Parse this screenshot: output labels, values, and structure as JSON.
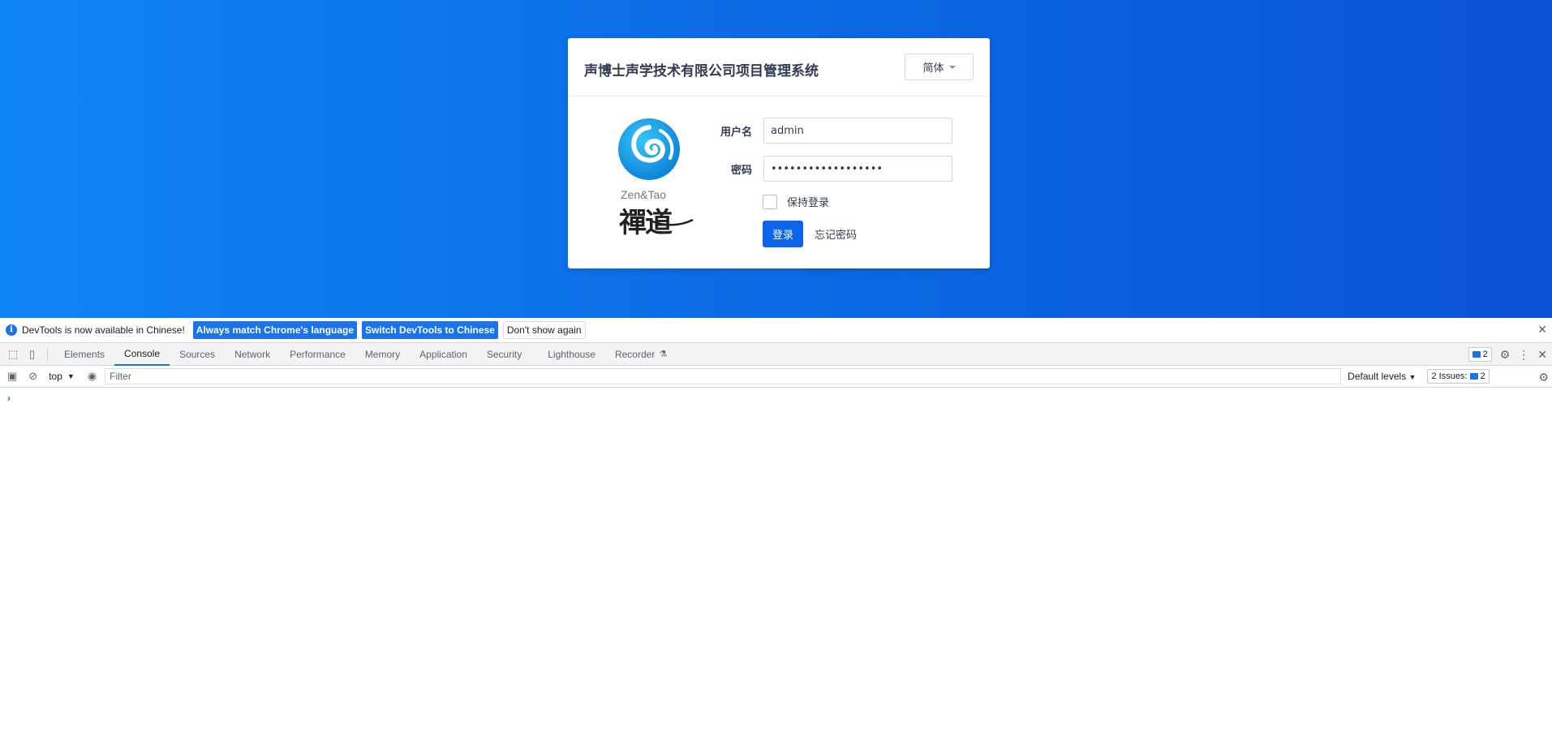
{
  "login": {
    "title": "声博士声学技术有限公司项目管理系统",
    "lang_button": "简体",
    "logo_text": "Zen&Tao",
    "logo_cjk": "禪道",
    "username_label": "用户名",
    "username_value": "admin",
    "password_label": "密码",
    "password_mask": "••••••••••••••••••",
    "keep_login_label": "保持登录",
    "submit_label": "登录",
    "forgot_label": "忘记密码"
  },
  "devtools": {
    "info_text": "DevTools is now available in Chinese!",
    "btn_match": "Always match Chrome's language",
    "btn_switch": "Switch DevTools to Chinese",
    "btn_dismiss": "Don't show again",
    "tabs": [
      "Elements",
      "Console",
      "Sources",
      "Network",
      "Performance",
      "Memory",
      "Application",
      "Security",
      "Lighthouse",
      "Recorder"
    ],
    "active_tab": "Console",
    "messages_count": "2",
    "context": "top",
    "filter_placeholder": "Filter",
    "levels": "Default levels",
    "issues_label": "2 Issues:",
    "issues_count": "2",
    "prompt": "›"
  },
  "colors": {
    "brand_blue": "#0c64eb",
    "devtools_blue": "#1a73e8"
  }
}
